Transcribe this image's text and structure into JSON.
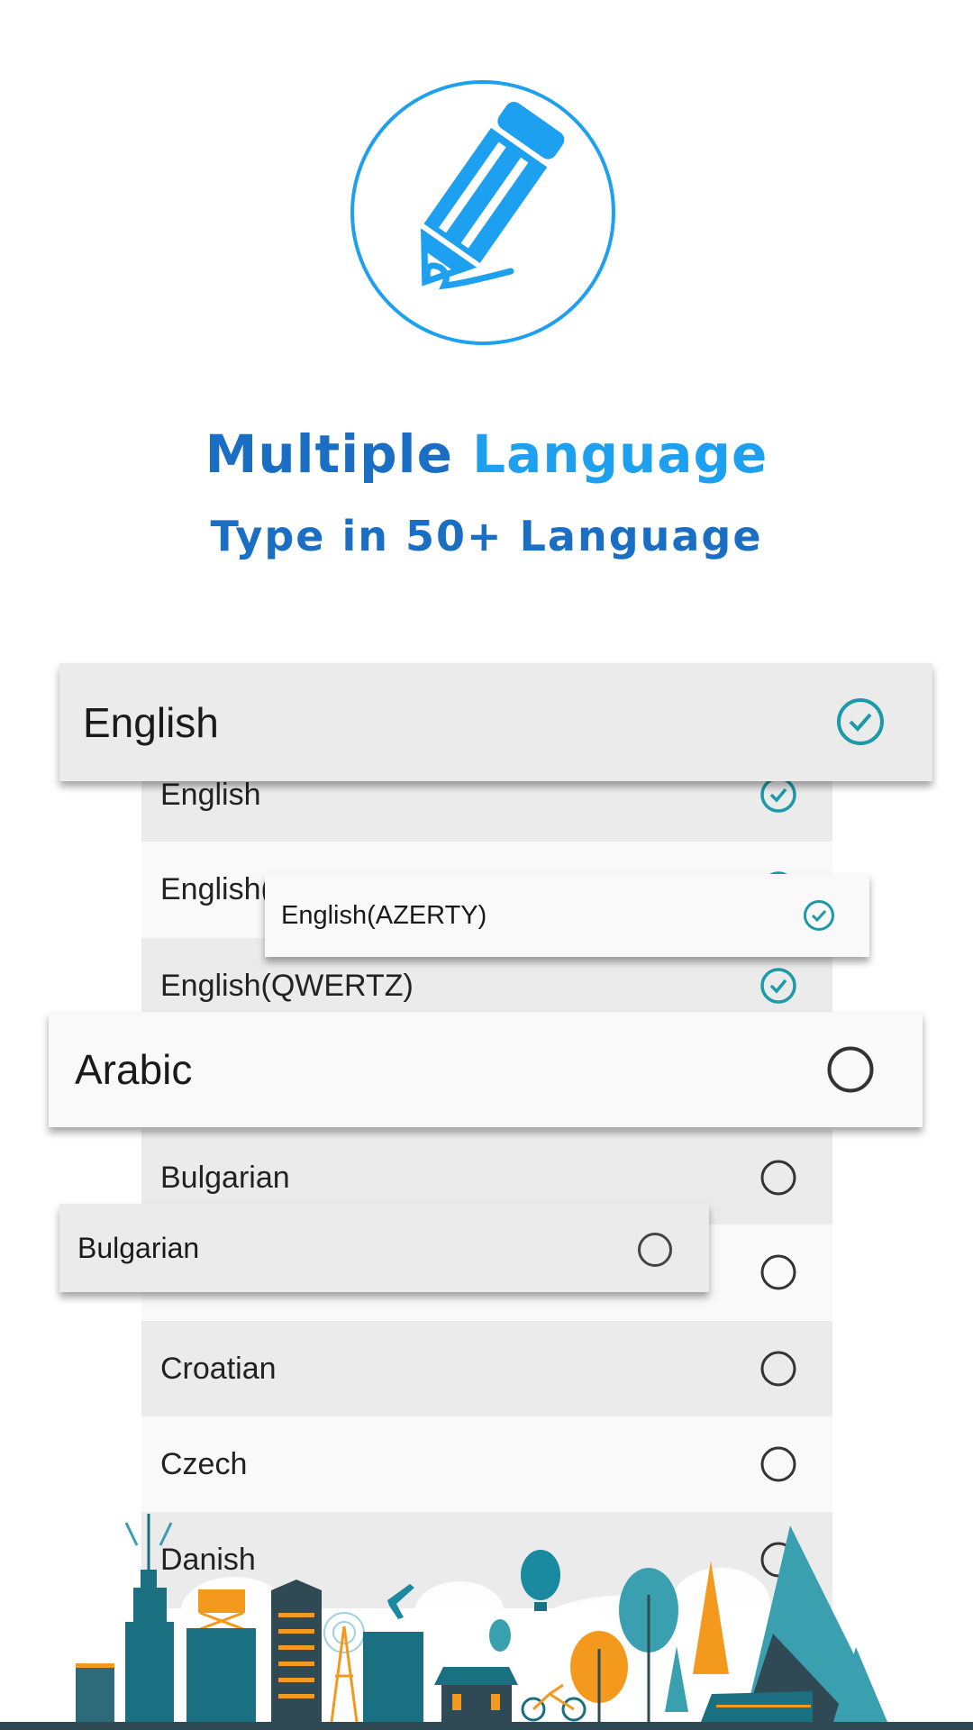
{
  "header": {
    "icon": "pencil-icon",
    "title_part1": "Multiple",
    "title_part2": "Language",
    "subtitle": "Type in 50+ Language"
  },
  "colors": {
    "title_dark": "#1a6fc4",
    "title_light": "#1ea0f0",
    "check_teal": "#1b9aa8",
    "row_dark": "#ebebeb",
    "row_light": "#f9f9f9"
  },
  "list": {
    "rows": [
      {
        "label": "English",
        "state": "checked"
      },
      {
        "label": "English(",
        "state": "checked"
      },
      {
        "label": "English(QWERTZ)",
        "state": "checked"
      },
      {
        "label": "",
        "state": "unchecked"
      },
      {
        "label": "Bulgarian",
        "state": "unchecked"
      },
      {
        "label": "",
        "state": "unchecked"
      },
      {
        "label": "Croatian",
        "state": "unchecked"
      },
      {
        "label": "Czech",
        "state": "unchecked"
      },
      {
        "label": "Danish",
        "state": "unchecked"
      }
    ]
  },
  "cards": {
    "english": {
      "label": "English",
      "state": "checked"
    },
    "azerty": {
      "label": "English(AZERTY)",
      "state": "checked"
    },
    "arabic": {
      "label": "Arabic",
      "state": "unchecked"
    },
    "bulgarian": {
      "label": "Bulgarian",
      "state": "unchecked"
    }
  },
  "illustration": "cityscape"
}
